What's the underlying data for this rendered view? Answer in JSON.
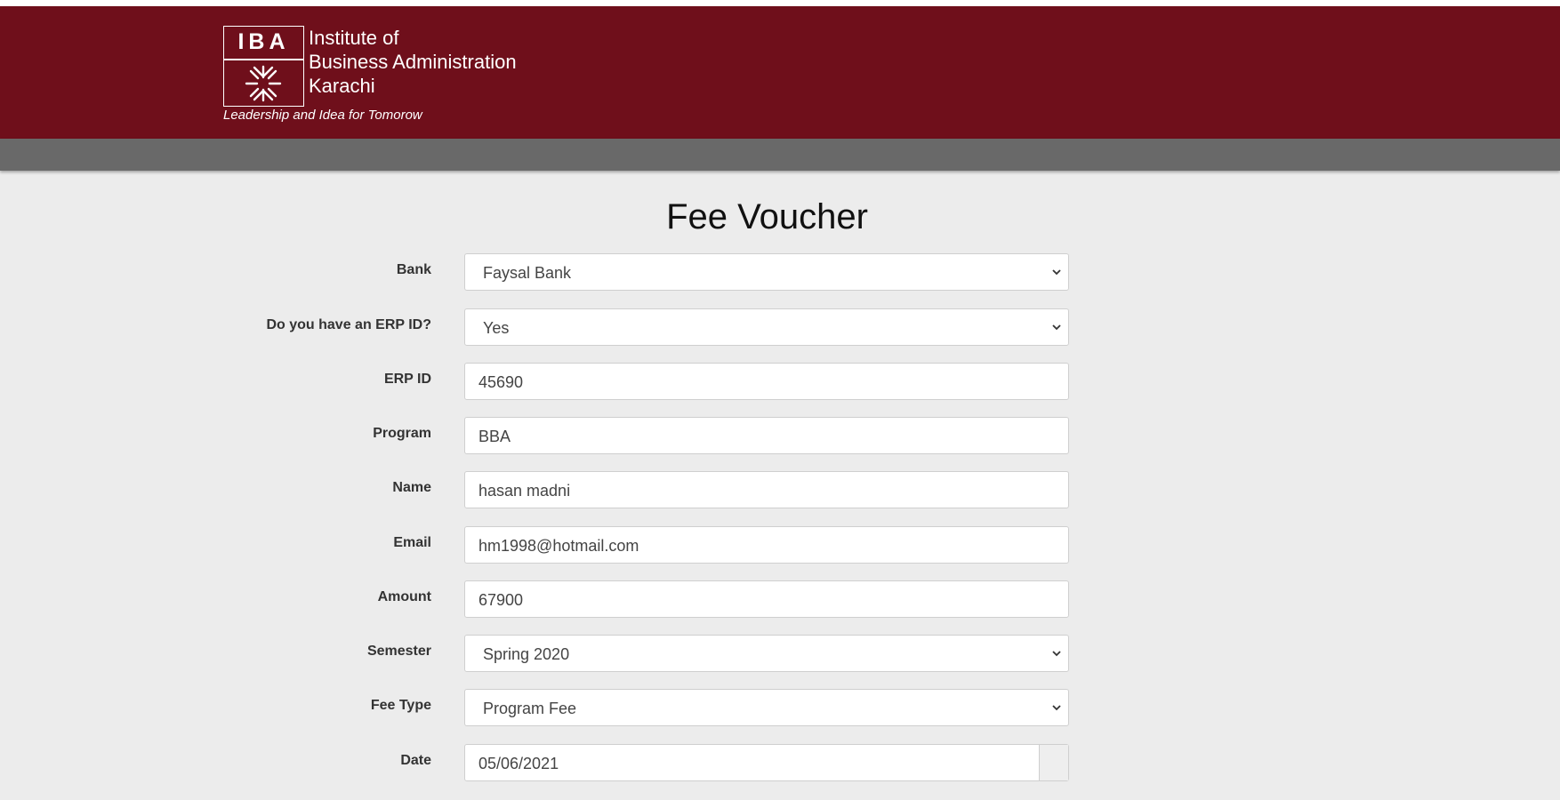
{
  "header": {
    "logo_text": "IBA",
    "institute_line1": "Institute of",
    "institute_line2": "Business Administration",
    "institute_line3": "Karachi",
    "tagline": "Leadership and Idea for Tomorow",
    "brand_color": "#6f0f1b"
  },
  "page": {
    "title": "Fee Voucher"
  },
  "form": {
    "bank": {
      "label": "Bank",
      "value": "Faysal Bank"
    },
    "has_erp": {
      "label": "Do you have an ERP ID?",
      "value": "Yes"
    },
    "erp_id": {
      "label": "ERP ID",
      "value": "45690"
    },
    "program": {
      "label": "Program",
      "value": "BBA"
    },
    "name": {
      "label": "Name",
      "value": "hasan madni"
    },
    "email": {
      "label": "Email",
      "value": "hm1998@hotmail.com"
    },
    "amount": {
      "label": "Amount",
      "value": "67900"
    },
    "semester": {
      "label": "Semester",
      "value": "Spring 2020"
    },
    "fee_type": {
      "label": "Fee Type",
      "value": "Program Fee"
    },
    "date": {
      "label": "Date",
      "value": "05/06/2021"
    }
  }
}
